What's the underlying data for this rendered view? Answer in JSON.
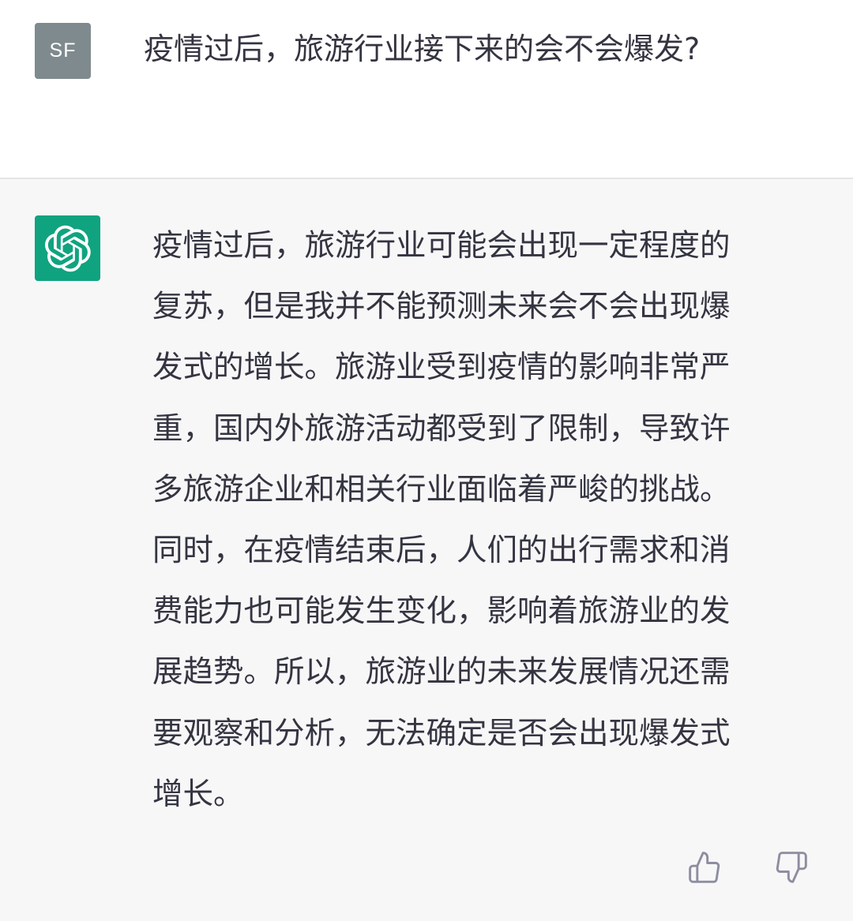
{
  "user_message": {
    "avatar_initials": "SF",
    "text": "疫情过后，旅游行业接下来的会不会爆发?"
  },
  "assistant_message": {
    "avatar_icon": "openai-logo-icon",
    "lines": [
      "疫情过后，旅游行业可能会出现一定程度的",
      "复苏，但是我并不能预测未来会不会出现爆",
      "发式的增长。旅游业受到疫情的影响非常严",
      "重，国内外旅游活动都受到了限制，导致许",
      "多旅游企业和相关行业面临着严峻的挑战。",
      "同时，在疫情结束后，人们的出行需求和消",
      "费能力也可能发生变化，影响着旅游业的发",
      "展趋势。所以，旅游业的未来发展情况还需",
      "要观察和分析，无法确定是否会出现爆发式",
      "增长。"
    ],
    "feedback": {
      "thumbs_up_icon": "thumbs-up-icon",
      "thumbs_down_icon": "thumbs-down-icon"
    }
  },
  "colors": {
    "user_avatar_bg": "#7f8a8e",
    "assistant_avatar_bg": "#10a37f",
    "assistant_row_bg": "#f7f7f8",
    "text": "#343541",
    "icon": "#8e8ea0"
  }
}
